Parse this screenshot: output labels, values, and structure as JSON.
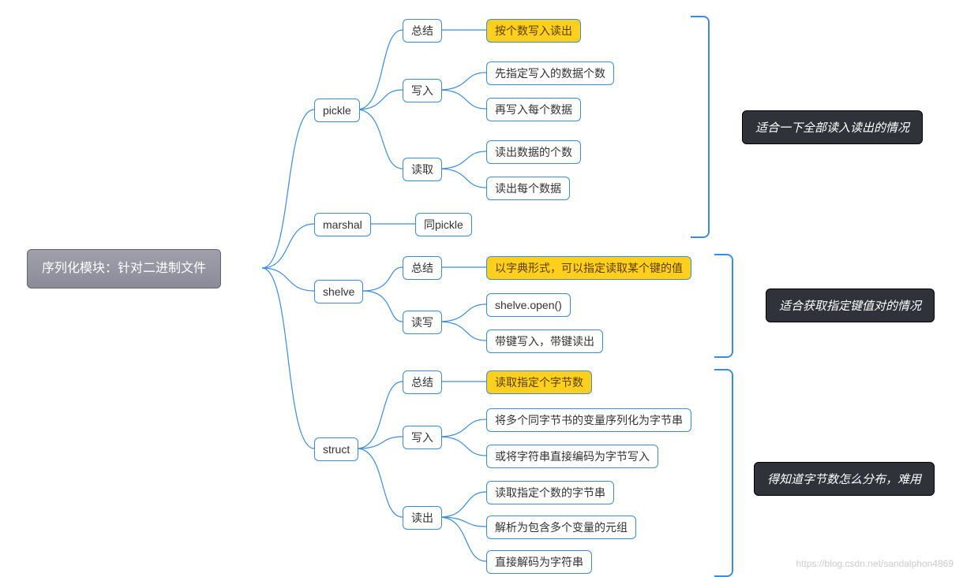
{
  "root": "序列化模块：针对二进制文件",
  "pickle": {
    "label": "pickle",
    "summary_label": "总结",
    "summary_value": "按个数写入读出",
    "write_label": "写入",
    "write_children": [
      "先指定写入的数据个数",
      "再写入每个数据"
    ],
    "read_label": "读取",
    "read_children": [
      "读出数据的个数",
      "读出每个数据"
    ]
  },
  "marshal": {
    "label": "marshal",
    "desc": "同pickle"
  },
  "shelve": {
    "label": "shelve",
    "summary_label": "总结",
    "summary_value": "以字典形式，可以指定读取某个键的值",
    "rw_label": "读写",
    "rw_children": [
      "shelve.open()",
      "带键写入，带键读出"
    ]
  },
  "struct": {
    "label": "struct",
    "summary_label": "总结",
    "summary_value": "读取指定个字节数",
    "write_label": "写入",
    "write_children": [
      "将多个同字节书的变量序列化为字节串",
      "或将字符串直接编码为字节写入"
    ],
    "read_label": "读出",
    "read_children": [
      "读取指定个数的字节串",
      "解析为包含多个变量的元组",
      "直接解码为字符串"
    ]
  },
  "notes": {
    "pickle": "适合一下全部读入读出的情况",
    "shelve": "适合获取指定键值对的情况",
    "struct": "得知道字节数怎么分布，难用"
  },
  "watermark": "https://blog.csdn.net/sandalphon4869"
}
